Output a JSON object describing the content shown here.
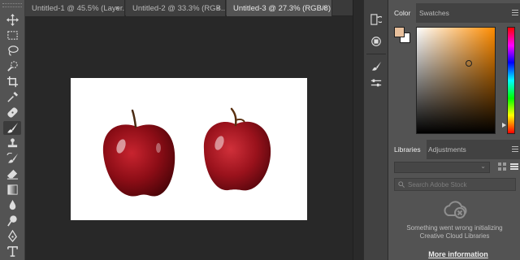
{
  "tabs": [
    {
      "label": "Untitled-1 @ 45.5% (Layer...",
      "close": "×",
      "active": false
    },
    {
      "label": "Untitled-2 @ 33.3% (RGB...",
      "close": "×",
      "active": false
    },
    {
      "label": "Untitled-3 @ 27.3% (RGB/8) *",
      "close": "×",
      "active": true
    }
  ],
  "tools": [
    "move-tool-icon",
    "marquee-tool-icon",
    "lasso-tool-icon",
    "quick-select-tool-icon",
    "crop-tool-icon",
    "eyedropper-tool-icon",
    "healing-brush-tool-icon",
    "brush-tool-icon",
    "clone-stamp-tool-icon",
    "history-brush-tool-icon",
    "eraser-tool-icon",
    "gradient-tool-icon",
    "blur-tool-icon",
    "dodge-tool-icon",
    "pen-tool-icon",
    "type-tool-icon"
  ],
  "active_tool": "brush-tool-icon",
  "color_panel": {
    "tabs": [
      "Color",
      "Swatches"
    ],
    "foreground_color": "#e8c09c",
    "background_color": "#ffffff",
    "hue_color": "#ff8c00"
  },
  "libraries_panel": {
    "tabs": [
      "Libraries",
      "Adjustments"
    ],
    "search_placeholder": "Search Adobe Stock",
    "message_line1": "Something went wrong initializing",
    "message_line2": "Creative Cloud Libraries",
    "more_info": "More information"
  },
  "canvas": {
    "document_background": "#ffffff",
    "content": [
      "red-apple-left",
      "red-apple-right"
    ]
  }
}
